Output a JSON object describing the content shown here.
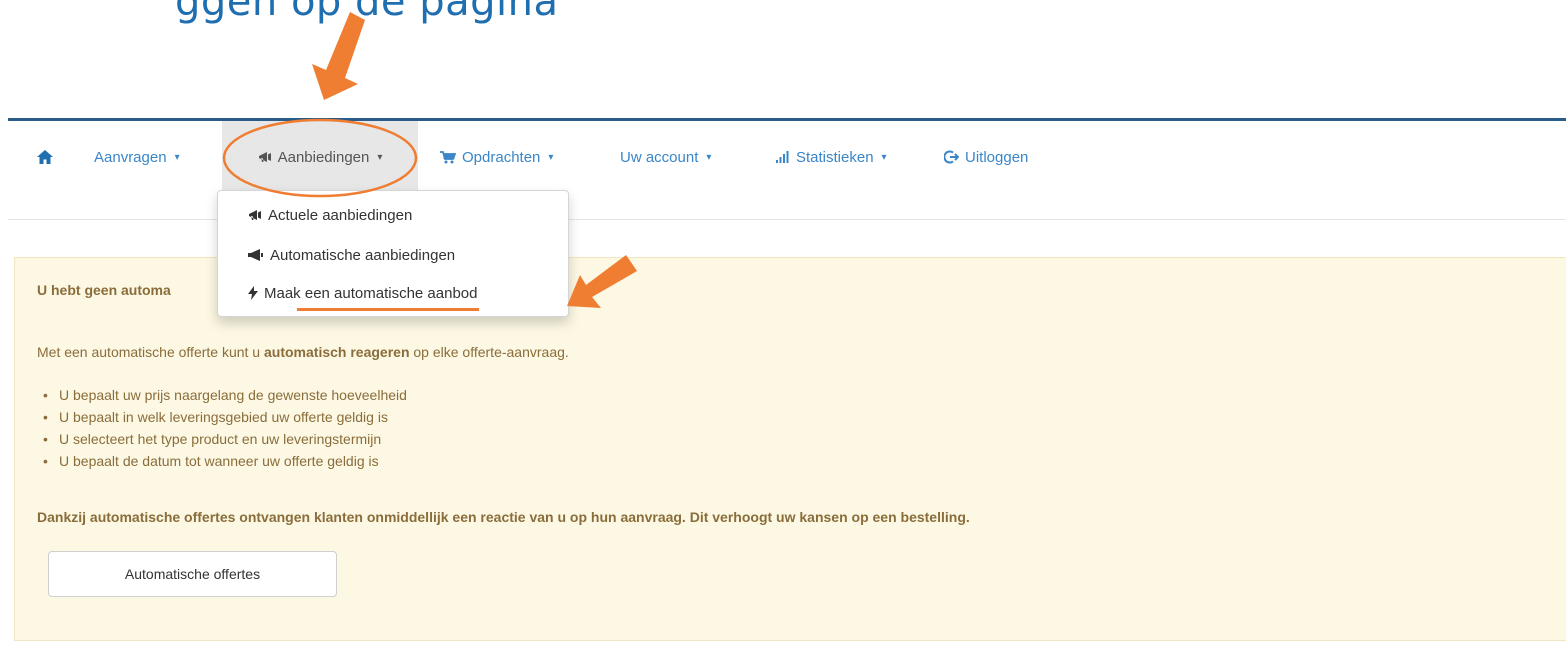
{
  "heading_fragment": "ggen op de pagina",
  "navbar": {
    "home_icon": "home-icon",
    "items": [
      {
        "label": "Aanvragen",
        "icon": ""
      },
      {
        "label": "Aanbiedingen",
        "icon": "megaphone-icon"
      },
      {
        "label": "Opdrachten",
        "icon": "cart-icon"
      },
      {
        "label": "Uw account",
        "icon": ""
      },
      {
        "label": "Statistieken",
        "icon": "signal-icon"
      },
      {
        "label": "Uitloggen",
        "icon": "logout-icon"
      }
    ],
    "active": "Aanbiedingen",
    "caret": "▾"
  },
  "dropdown": {
    "items": [
      {
        "label": "Actuele aanbiedingen",
        "icon": "megaphone-icon"
      },
      {
        "label": "Automatische aanbiedingen",
        "icon": "bullhorn-icon"
      },
      {
        "label": "Maak een automatische aanbod",
        "icon": "lightning-icon"
      }
    ]
  },
  "alert": {
    "title": "U hebt geen automa",
    "intro_start": "Met een automatische offerte kunt u ",
    "intro_bold": "automatisch reageren",
    "intro_end": " op elke offerte-aanvraag.",
    "list": [
      "U bepaalt uw prijs naargelang de gewenste hoeveelheid",
      "U bepaalt in welk leveringsgebied uw offerte geldig is",
      "U selecteert het type product en uw leveringstermijn",
      "U bepaalt de datum tot wanneer uw offerte geldig is"
    ],
    "footer": "Dankzij automatische offertes ontvangen klanten onmiddellijk een reactie van u op hun aanvraag. Dit verhoogt uw kansen op een bestelling.",
    "button_label": "Automatische offertes"
  },
  "colors": {
    "nav_link": "#3a86c8",
    "alert_bg": "#fcf8e3",
    "alert_text": "#8a6d3b",
    "annotation": "#ef7d32",
    "heading": "#1f6fb0"
  }
}
